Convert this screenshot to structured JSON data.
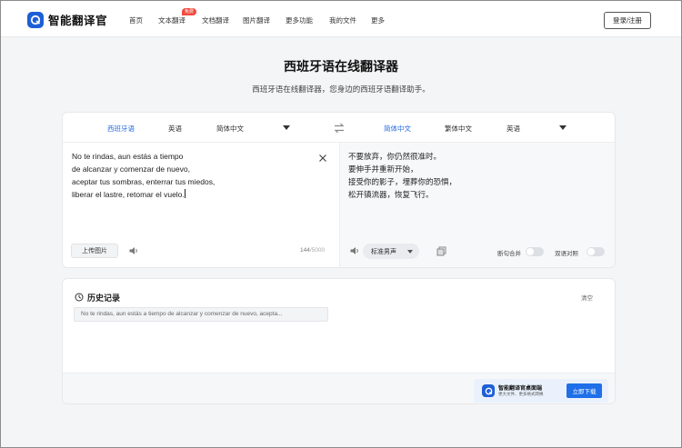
{
  "header": {
    "logo_text": "智能翻译官",
    "nav": [
      "首页",
      "文本翻译",
      "文档翻译",
      "图片翻译",
      "更多功能",
      "我的文件",
      "更多"
    ],
    "badge": "免费",
    "login": "登录/注册"
  },
  "page": {
    "title": "西班牙语在线翻译器",
    "subtitle": "西班牙语在线翻译器，您身边的西班牙语翻译助手。"
  },
  "translator": {
    "source_langs": [
      "西班牙语",
      "英语",
      "简体中文"
    ],
    "target_langs": [
      "简体中文",
      "繁体中文",
      "英语"
    ],
    "source_lines": [
      "No te rindas, aun estás a tiempo",
      "de alcanzar y comenzar de nuevo,",
      "aceptar tus sombras, enterrar tus miedos,",
      "liberar el lastre, retomar el vuelo."
    ],
    "upload_label": "上传图片",
    "char_count": "144",
    "char_max": "/5000",
    "target_lines": [
      "不要放弃，你仍然很准时。",
      "要伸手并重新开始，",
      "接受你的影子，埋葬你的恐惧，",
      "松开镇流器，恢复飞行。"
    ],
    "voice": "标准男声",
    "toggle_split": "断句合并",
    "toggle_bilingual": "双语对照",
    "accent_color": "#2b6de0"
  },
  "history": {
    "title": "历史记录",
    "clear": "清空",
    "items": [
      "No te rindas, aun estás a tiempo de alcanzar y comenzar de nuevo, acepta..."
    ]
  },
  "promo": {
    "title": "智能翻译官桌面端",
    "subtitle": "更大文件、更多格式转换",
    "button": "立即下载"
  }
}
